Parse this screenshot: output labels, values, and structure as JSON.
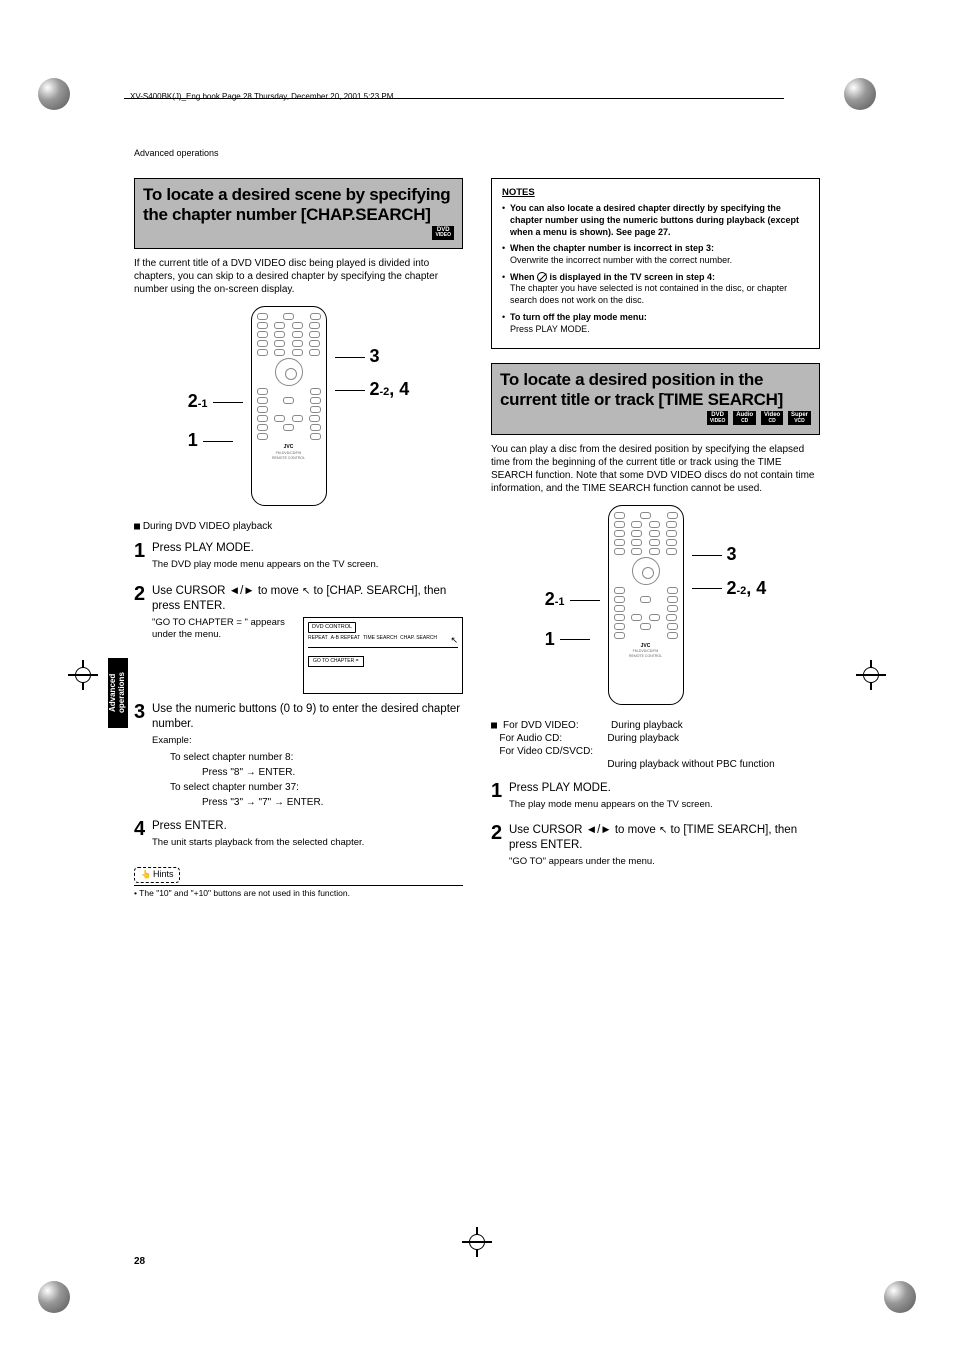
{
  "header": "XV-S400BK(J)_Eng.book  Page 28  Thursday, December 20, 2001  5:23 PM",
  "breadcrumb": "Advanced operations",
  "side_tab": "Advanced operations",
  "page_number": "28",
  "col_left": {
    "title": "To locate a desired scene by specifying the chapter number [CHAP.SEARCH]",
    "badges": [
      "DVD VIDEO"
    ],
    "intro": "If the current title of a DVD VIDEO disc being played is divided into chapters, you can skip to a desired chapter by specifying the chapter number using the on-screen display.",
    "diagram_labels": {
      "a": "3",
      "b": "2-2, 4",
      "c": "2-1",
      "d": "1"
    },
    "playback": "During DVD VIDEO playback",
    "steps": [
      {
        "num": "1",
        "head": "Press PLAY MODE.",
        "text": "The DVD play mode menu appears on the TV screen."
      },
      {
        "num": "2",
        "head": "Use CURSOR ◄/► to move ↖ to [CHAP. SEARCH], then press ENTER.",
        "text": "\"GO TO CHAPTER = \" appears under the menu.",
        "menu": {
          "control": "DVD CONTROL",
          "tabs": [
            "REPEAT",
            "A-B REPEAT",
            "TIME SEARCH",
            "CHAP. SEARCH"
          ],
          "goto": "GO TO CHAPTER ="
        }
      },
      {
        "num": "3",
        "head": "Use the numeric buttons (0 to 9) to enter the desired chapter number.",
        "example_label": "Example:",
        "lines": [
          "To select chapter number 8:",
          "Press \"8\" → ENTER.",
          "To select chapter number 37:",
          "Press \"3\" → \"7\" → ENTER."
        ]
      },
      {
        "num": "4",
        "head": "Press ENTER.",
        "text": "The unit starts playback from the selected chapter."
      }
    ],
    "hints_label": "Hints",
    "hints_text": "• The \"10\" and \"+10\" buttons are not used in this function."
  },
  "col_right": {
    "notes_title": "NOTES",
    "notes": [
      {
        "bold": "You can also locate a desired chapter directly by specifying the chapter number using the numeric buttons during playback (except when a menu is shown). See page 27.",
        "plain": ""
      },
      {
        "bold": "When the chapter number is incorrect in step 3:",
        "plain": "Overwrite the incorrect number with the correct number."
      },
      {
        "bold_pre": "When ",
        "bold_post": " is displayed in the TV screen in step 4:",
        "plain": "The chapter you have selected is not contained in the disc, or chapter search does not work on the disc."
      },
      {
        "bold": "To turn off the play mode menu:",
        "plain": "Press PLAY MODE."
      }
    ],
    "title": "To locate a desired position in the current title or track [TIME SEARCH]",
    "badges": [
      "DVD VIDEO",
      "Audio CD",
      "Video CD",
      "Super VCD"
    ],
    "intro": "You can play a disc from the desired position by specifying the elapsed time from the beginning of the current title or track using the TIME SEARCH function. Note that some DVD VIDEO discs do not contain time information, and the TIME SEARCH function cannot be used.",
    "diagram_labels": {
      "a": "3",
      "b": "2-2, 4",
      "c": "2-1",
      "d": "1"
    },
    "for": [
      {
        "l": "For DVD VIDEO:",
        "r": "During playback"
      },
      {
        "l": "For Audio CD:",
        "r": "During playback"
      },
      {
        "l": "For Video CD/SVCD:",
        "r": ""
      },
      {
        "l": "",
        "r": "During playback without PBC function"
      }
    ],
    "steps": [
      {
        "num": "1",
        "head": "Press PLAY MODE.",
        "text": "The play mode menu appears on the TV screen."
      },
      {
        "num": "2",
        "head": "Use CURSOR ◄/► to move ↖  to [TIME SEARCH],  then press ENTER.",
        "text": "\"GO TO\" appears under the menu."
      }
    ]
  }
}
